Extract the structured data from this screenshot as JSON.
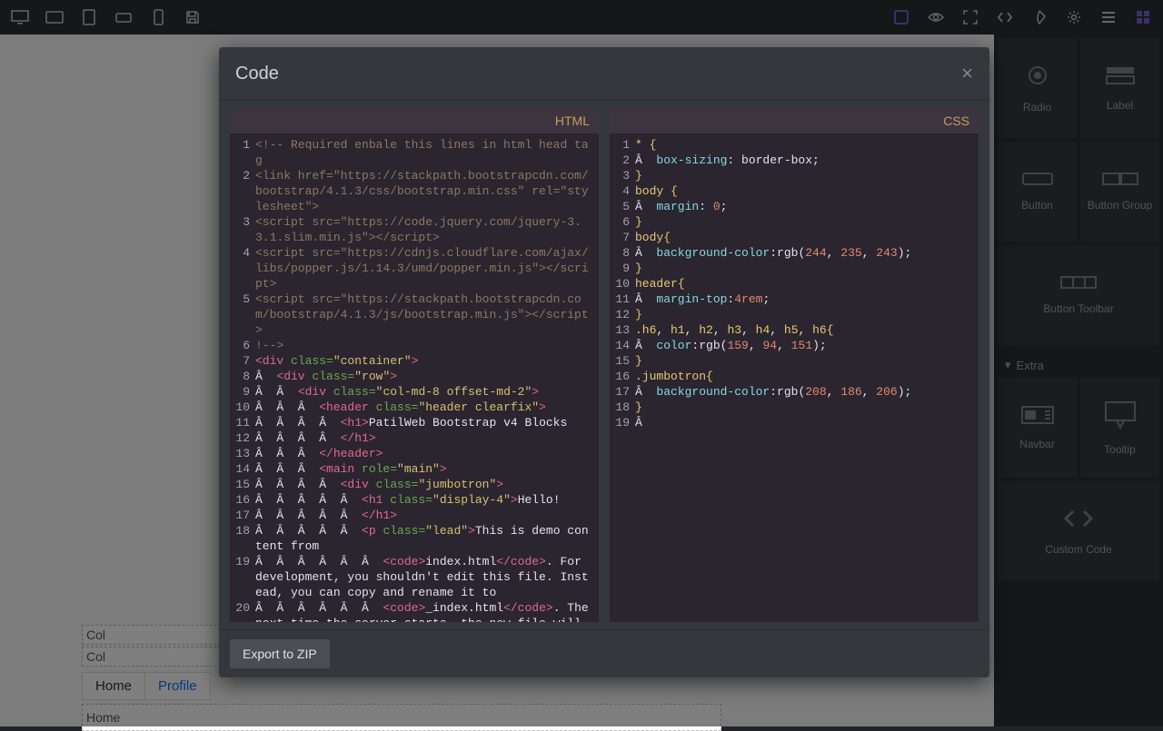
{
  "toolbar": {
    "left_icons": [
      "desktop",
      "tablet-landscape",
      "tablet-portrait",
      "phone-landscape",
      "phone-portrait",
      "save"
    ],
    "right_icons": [
      "layers",
      "preview",
      "fullscreen",
      "code-toggle",
      "paint",
      "settings",
      "menu",
      "grid"
    ]
  },
  "right_panel": {
    "groups": [
      {
        "tiles": [
          {
            "icon": "radio",
            "label": "Radio"
          },
          {
            "icon": "label",
            "label": "Label"
          }
        ]
      },
      {
        "tiles": [
          {
            "icon": "button",
            "label": "Button"
          },
          {
            "icon": "button-group",
            "label": "Button Group"
          }
        ]
      },
      {
        "tiles": [
          {
            "icon": "button-toolbar",
            "label": "Button Toolbar"
          }
        ]
      },
      {
        "header": "Extra",
        "tiles": [
          {
            "icon": "navbar",
            "label": "Navbar"
          },
          {
            "icon": "tooltip",
            "label": "Tooltip"
          }
        ]
      },
      {
        "tiles": [
          {
            "icon": "custom-code",
            "label": "Custom Code"
          }
        ]
      }
    ]
  },
  "bg_canvas": {
    "rows": [
      "Col",
      "Col"
    ],
    "tabs": [
      {
        "label": "Home",
        "active": true
      },
      {
        "label": "Profile",
        "active": false
      }
    ],
    "tabpane": "Home"
  },
  "modal": {
    "title": "Code",
    "export_label": "Export to ZIP",
    "html_label": "HTML",
    "css_label": "CSS",
    "html_lines": [
      {
        "n": 1,
        "segs": [
          {
            "t": "<!-- Required enbale this lines in html head tag",
            "c": "c-comment"
          }
        ]
      },
      {
        "n": 2,
        "segs": [
          {
            "t": "<link href=\"https://stackpath.bootstrapcdn.com/bootstrap/4.1.3/css/bootstrap.min.css\" rel=\"stylesheet\">",
            "c": "c-comment"
          }
        ]
      },
      {
        "n": 3,
        "segs": [
          {
            "t": "<script src=\"https://code.jquery.com/jquery-3.3.1.slim.min.js\"></script>",
            "c": "c-comment"
          }
        ]
      },
      {
        "n": 4,
        "segs": [
          {
            "t": "<script src=\"https://cdnjs.cloudflare.com/ajax/libs/popper.js/1.14.3/umd/popper.min.js\"></script>",
            "c": "c-comment"
          }
        ]
      },
      {
        "n": 5,
        "segs": [
          {
            "t": "<script src=\"https://stackpath.bootstrapcdn.com/bootstrap/4.1.3/js/bootstrap.min.js\"></script>",
            "c": "c-comment"
          }
        ]
      },
      {
        "n": 6,
        "segs": [
          {
            "t": "!-->",
            "c": "c-comment"
          }
        ]
      },
      {
        "n": 7,
        "segs": [
          {
            "t": "<div ",
            "c": "c-tag"
          },
          {
            "t": "class=",
            "c": "c-attr"
          },
          {
            "t": "\"container\"",
            "c": "c-val"
          },
          {
            "t": ">",
            "c": "c-tag"
          }
        ]
      },
      {
        "n": 8,
        "segs": [
          {
            "t": "Â  ",
            "c": "c-plain"
          },
          {
            "t": "<div ",
            "c": "c-tag"
          },
          {
            "t": "class=",
            "c": "c-attr"
          },
          {
            "t": "\"row\"",
            "c": "c-val"
          },
          {
            "t": ">",
            "c": "c-tag"
          }
        ]
      },
      {
        "n": 9,
        "segs": [
          {
            "t": "Â  Â  ",
            "c": "c-plain"
          },
          {
            "t": "<div ",
            "c": "c-tag"
          },
          {
            "t": "class=",
            "c": "c-attr"
          },
          {
            "t": "\"col-md-8 offset-md-2\"",
            "c": "c-val"
          },
          {
            "t": ">",
            "c": "c-tag"
          }
        ]
      },
      {
        "n": 10,
        "segs": [
          {
            "t": "Â  Â  Â  ",
            "c": "c-plain"
          },
          {
            "t": "<header ",
            "c": "c-tag"
          },
          {
            "t": "class=",
            "c": "c-attr"
          },
          {
            "t": "\"header clearfix\"",
            "c": "c-val"
          },
          {
            "t": ">",
            "c": "c-tag"
          }
        ]
      },
      {
        "n": 11,
        "segs": [
          {
            "t": "Â  Â  Â  Â  ",
            "c": "c-plain"
          },
          {
            "t": "<h1>",
            "c": "c-tag"
          },
          {
            "t": "PatilWeb Bootstrap v4 Blocks",
            "c": "c-plain"
          }
        ]
      },
      {
        "n": 12,
        "segs": [
          {
            "t": "Â  Â  Â  Â  ",
            "c": "c-plain"
          },
          {
            "t": "</h1>",
            "c": "c-tag"
          }
        ]
      },
      {
        "n": 13,
        "segs": [
          {
            "t": "Â  Â  Â  ",
            "c": "c-plain"
          },
          {
            "t": "</header>",
            "c": "c-tag"
          }
        ]
      },
      {
        "n": 14,
        "segs": [
          {
            "t": "Â  Â  Â  ",
            "c": "c-plain"
          },
          {
            "t": "<main ",
            "c": "c-tag"
          },
          {
            "t": "role=",
            "c": "c-attr"
          },
          {
            "t": "\"main\"",
            "c": "c-val"
          },
          {
            "t": ">",
            "c": "c-tag"
          }
        ]
      },
      {
        "n": 15,
        "segs": [
          {
            "t": "Â  Â  Â  Â  ",
            "c": "c-plain"
          },
          {
            "t": "<div ",
            "c": "c-tag"
          },
          {
            "t": "class=",
            "c": "c-attr"
          },
          {
            "t": "\"jumbotron\"",
            "c": "c-val"
          },
          {
            "t": ">",
            "c": "c-tag"
          }
        ]
      },
      {
        "n": 16,
        "segs": [
          {
            "t": "Â  Â  Â  Â  Â  ",
            "c": "c-plain"
          },
          {
            "t": "<h1 ",
            "c": "c-tag"
          },
          {
            "t": "class=",
            "c": "c-attr"
          },
          {
            "t": "\"display-4\"",
            "c": "c-val"
          },
          {
            "t": ">",
            "c": "c-tag"
          },
          {
            "t": "Hello!",
            "c": "c-plain"
          }
        ]
      },
      {
        "n": 17,
        "segs": [
          {
            "t": "Â  Â  Â  Â  Â  ",
            "c": "c-plain"
          },
          {
            "t": "</h1>",
            "c": "c-tag"
          }
        ]
      },
      {
        "n": 18,
        "segs": [
          {
            "t": "Â  Â  Â  Â  Â  ",
            "c": "c-plain"
          },
          {
            "t": "<p ",
            "c": "c-tag"
          },
          {
            "t": "class=",
            "c": "c-attr"
          },
          {
            "t": "\"lead\"",
            "c": "c-val"
          },
          {
            "t": ">",
            "c": "c-tag"
          },
          {
            "t": "This is demo content from",
            "c": "c-plain"
          }
        ]
      },
      {
        "n": 19,
        "segs": [
          {
            "t": "Â  Â  Â  Â  Â  Â  ",
            "c": "c-plain"
          },
          {
            "t": "<code>",
            "c": "c-tag"
          },
          {
            "t": "index.html",
            "c": "c-plain"
          },
          {
            "t": "</code>",
            "c": "c-tag"
          },
          {
            "t": ". For development, you shouldn't edit this file. Instead, you can copy and rename it to",
            "c": "c-plain"
          }
        ]
      },
      {
        "n": 20,
        "segs": [
          {
            "t": "Â  Â  Â  Â  Â  Â  ",
            "c": "c-plain"
          },
          {
            "t": "<code>",
            "c": "c-tag"
          },
          {
            "t": "_index.html",
            "c": "c-plain"
          },
          {
            "t": "</code>",
            "c": "c-tag"
          },
          {
            "t": ". The next time the server starts, the new file will be served, and it will be ignored by git.",
            "c": "c-plain"
          }
        ]
      }
    ],
    "css_lines": [
      {
        "n": 1,
        "segs": [
          {
            "t": "* {",
            "c": "c-sel"
          }
        ]
      },
      {
        "n": 2,
        "segs": [
          {
            "t": "Â  ",
            "c": "c-plain"
          },
          {
            "t": "box-sizing",
            "c": "c-css"
          },
          {
            "t": ": border-box",
            "c": "c-plain"
          },
          {
            "t": ";",
            "c": "c-plain"
          }
        ]
      },
      {
        "n": 3,
        "segs": [
          {
            "t": "}",
            "c": "c-sel"
          }
        ]
      },
      {
        "n": 4,
        "segs": [
          {
            "t": "body ",
            "c": "c-sel"
          },
          {
            "t": "{",
            "c": "c-sel"
          }
        ]
      },
      {
        "n": 5,
        "segs": [
          {
            "t": "Â  ",
            "c": "c-plain"
          },
          {
            "t": "margin",
            "c": "c-css"
          },
          {
            "t": ": ",
            "c": "c-plain"
          },
          {
            "t": "0",
            "c": "c-num"
          },
          {
            "t": ";",
            "c": "c-plain"
          }
        ]
      },
      {
        "n": 6,
        "segs": [
          {
            "t": "}",
            "c": "c-sel"
          }
        ]
      },
      {
        "n": 7,
        "segs": [
          {
            "t": "body",
            "c": "c-sel"
          },
          {
            "t": "{",
            "c": "c-sel"
          }
        ]
      },
      {
        "n": 8,
        "segs": [
          {
            "t": "Â  ",
            "c": "c-plain"
          },
          {
            "t": "background-color",
            "c": "c-css"
          },
          {
            "t": ":rgb(",
            "c": "c-plain"
          },
          {
            "t": "244",
            "c": "c-num"
          },
          {
            "t": ", ",
            "c": "c-plain"
          },
          {
            "t": "235",
            "c": "c-num"
          },
          {
            "t": ", ",
            "c": "c-plain"
          },
          {
            "t": "243",
            "c": "c-num"
          },
          {
            "t": ");",
            "c": "c-plain"
          }
        ]
      },
      {
        "n": 9,
        "segs": [
          {
            "t": "}",
            "c": "c-sel"
          }
        ]
      },
      {
        "n": 10,
        "segs": [
          {
            "t": "header",
            "c": "c-sel"
          },
          {
            "t": "{",
            "c": "c-sel"
          }
        ]
      },
      {
        "n": 11,
        "segs": [
          {
            "t": "Â  ",
            "c": "c-plain"
          },
          {
            "t": "margin-top",
            "c": "c-css"
          },
          {
            "t": ":",
            "c": "c-plain"
          },
          {
            "t": "4rem",
            "c": "c-num"
          },
          {
            "t": ";",
            "c": "c-plain"
          }
        ]
      },
      {
        "n": 12,
        "segs": [
          {
            "t": "}",
            "c": "c-sel"
          }
        ]
      },
      {
        "n": 13,
        "segs": [
          {
            "t": ".h6",
            "c": "c-sel"
          },
          {
            "t": ", ",
            "c": "c-plain"
          },
          {
            "t": "h1",
            "c": "c-sel"
          },
          {
            "t": ", ",
            "c": "c-plain"
          },
          {
            "t": "h2",
            "c": "c-sel"
          },
          {
            "t": ", ",
            "c": "c-plain"
          },
          {
            "t": "h3",
            "c": "c-sel"
          },
          {
            "t": ", ",
            "c": "c-plain"
          },
          {
            "t": "h4",
            "c": "c-sel"
          },
          {
            "t": ", ",
            "c": "c-plain"
          },
          {
            "t": "h5",
            "c": "c-sel"
          },
          {
            "t": ", ",
            "c": "c-plain"
          },
          {
            "t": "h6",
            "c": "c-sel"
          },
          {
            "t": "{",
            "c": "c-sel"
          }
        ]
      },
      {
        "n": 14,
        "segs": [
          {
            "t": "Â  ",
            "c": "c-plain"
          },
          {
            "t": "color",
            "c": "c-css"
          },
          {
            "t": ":rgb(",
            "c": "c-plain"
          },
          {
            "t": "159",
            "c": "c-num"
          },
          {
            "t": ", ",
            "c": "c-plain"
          },
          {
            "t": "94",
            "c": "c-num"
          },
          {
            "t": ", ",
            "c": "c-plain"
          },
          {
            "t": "151",
            "c": "c-num"
          },
          {
            "t": ");",
            "c": "c-plain"
          }
        ]
      },
      {
        "n": 15,
        "segs": [
          {
            "t": "}",
            "c": "c-sel"
          }
        ]
      },
      {
        "n": 16,
        "segs": [
          {
            "t": ".jumbotron",
            "c": "c-sel"
          },
          {
            "t": "{",
            "c": "c-sel"
          }
        ]
      },
      {
        "n": 17,
        "segs": [
          {
            "t": "Â  ",
            "c": "c-plain"
          },
          {
            "t": "background-color",
            "c": "c-css"
          },
          {
            "t": ":rgb(",
            "c": "c-plain"
          },
          {
            "t": "208",
            "c": "c-num"
          },
          {
            "t": ", ",
            "c": "c-plain"
          },
          {
            "t": "186",
            "c": "c-num"
          },
          {
            "t": ", ",
            "c": "c-plain"
          },
          {
            "t": "206",
            "c": "c-num"
          },
          {
            "t": ");",
            "c": "c-plain"
          }
        ]
      },
      {
        "n": 18,
        "segs": [
          {
            "t": "}",
            "c": "c-sel"
          }
        ]
      },
      {
        "n": 19,
        "segs": [
          {
            "t": "Â ",
            "c": "c-plain"
          }
        ]
      }
    ]
  }
}
